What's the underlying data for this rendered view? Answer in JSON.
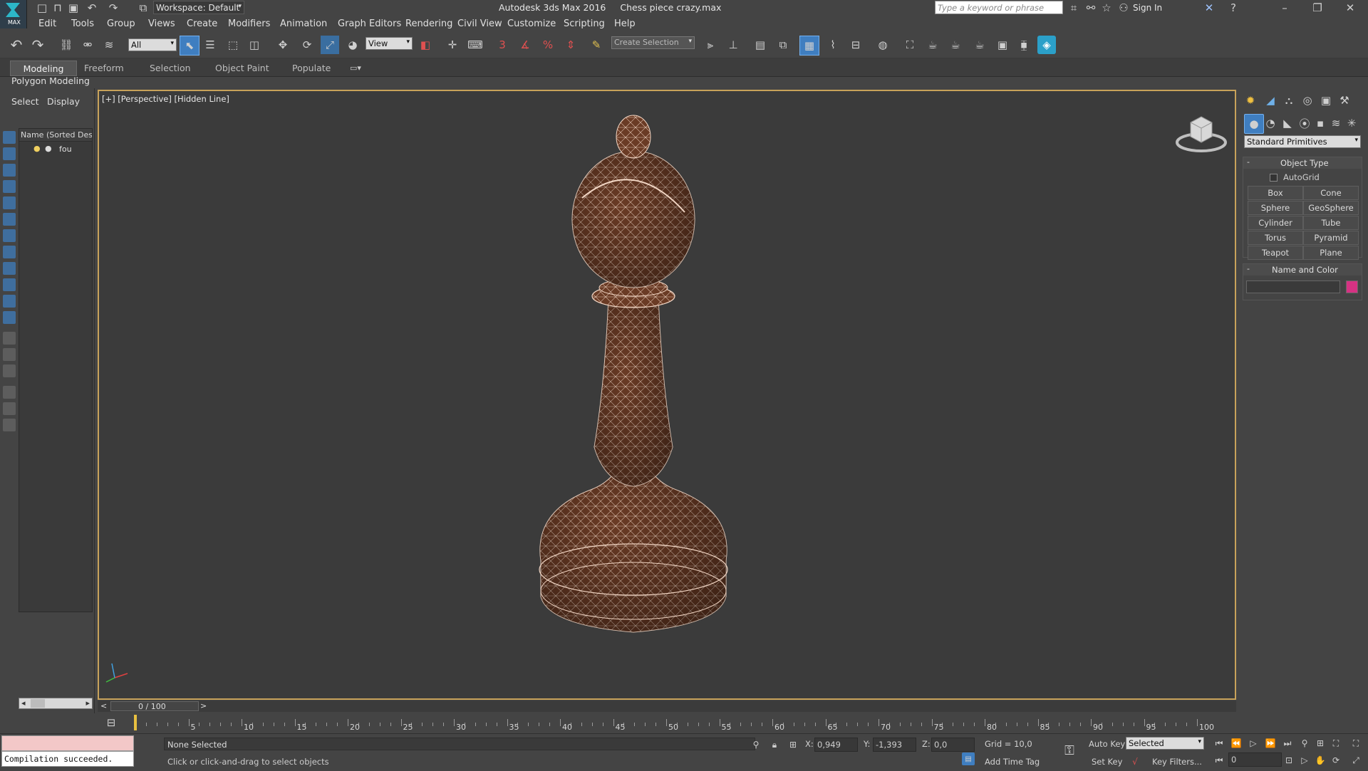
{
  "titlebar": {
    "app_title": "Autodesk 3ds Max 2016",
    "file_name": "Chess piece crazy.max",
    "workspace": "Workspace: Default",
    "search_placeholder": "Type a keyword or phrase",
    "sign_in": "Sign In",
    "logo_text": "MAX"
  },
  "menu": [
    "Edit",
    "Tools",
    "Group",
    "Views",
    "Create",
    "Modifiers",
    "Animation",
    "Graph Editors",
    "Rendering",
    "Civil View",
    "Customize",
    "Scripting",
    "Help"
  ],
  "toolbar": {
    "filter_value": "All",
    "coord_value": "View",
    "selection_set_placeholder": "Create Selection Se",
    "snap_3": "3",
    "snap_percent": "%"
  },
  "ribbon": {
    "tabs": [
      "Modeling",
      "Freeform",
      "Selection",
      "Object Paint",
      "Populate"
    ],
    "sub_label": "Polygon Modeling"
  },
  "scene_explorer": {
    "tabs": [
      "Select",
      "Display"
    ],
    "column_header": "Name (Sorted Desce",
    "items": [
      "fou"
    ]
  },
  "viewport": {
    "label": "[+] [Perspective] [Hidden Line]",
    "accent_border": "#c8a25a",
    "mesh_color": "#6a3b25",
    "wire_color": "#f2d6c4"
  },
  "command_panel": {
    "dropdown": "Standard Primitives",
    "rollout_object_type": "Object Type",
    "autogrid": "AutoGrid",
    "buttons": [
      "Box",
      "Cone",
      "Sphere",
      "GeoSphere",
      "Cylinder",
      "Tube",
      "Torus",
      "Pyramid",
      "Teapot",
      "Plane"
    ],
    "rollout_name_color": "Name and Color",
    "name_value": "",
    "swatch_color": "#d63283",
    "collapse_symbol": "-"
  },
  "timeline": {
    "slider_label": "0 / 100",
    "left_arrow": "<",
    "right_arrow": ">",
    "ticks": [
      0,
      5,
      10,
      15,
      20,
      25,
      30,
      35,
      40,
      45,
      50,
      55,
      60,
      65,
      70,
      75,
      80,
      85,
      90,
      95,
      100
    ],
    "tick_labels": [
      "5",
      "10",
      "15",
      "20",
      "25",
      "30",
      "35",
      "40",
      "45",
      "50",
      "55",
      "60",
      "65",
      "70",
      "75",
      "80",
      "85",
      "90",
      "95",
      "100"
    ],
    "current_frame": 0,
    "total_frames": 100
  },
  "status": {
    "listener_output": "Compilation succeeded.",
    "selection": "None Selected",
    "prompt": "Click or click-and-drag to select objects",
    "x_label": "X:",
    "x_value": "0,949",
    "y_label": "Y:",
    "y_value": "-1,393",
    "z_label": "Z:",
    "z_value": "0,0",
    "grid": "Grid = 10,0",
    "add_time_tag": "Add Time Tag",
    "auto_key": "Auto Key",
    "set_key": "Set Key",
    "key_mode": "Selected",
    "key_filters": "Key Filters...",
    "frame_field": "0"
  }
}
